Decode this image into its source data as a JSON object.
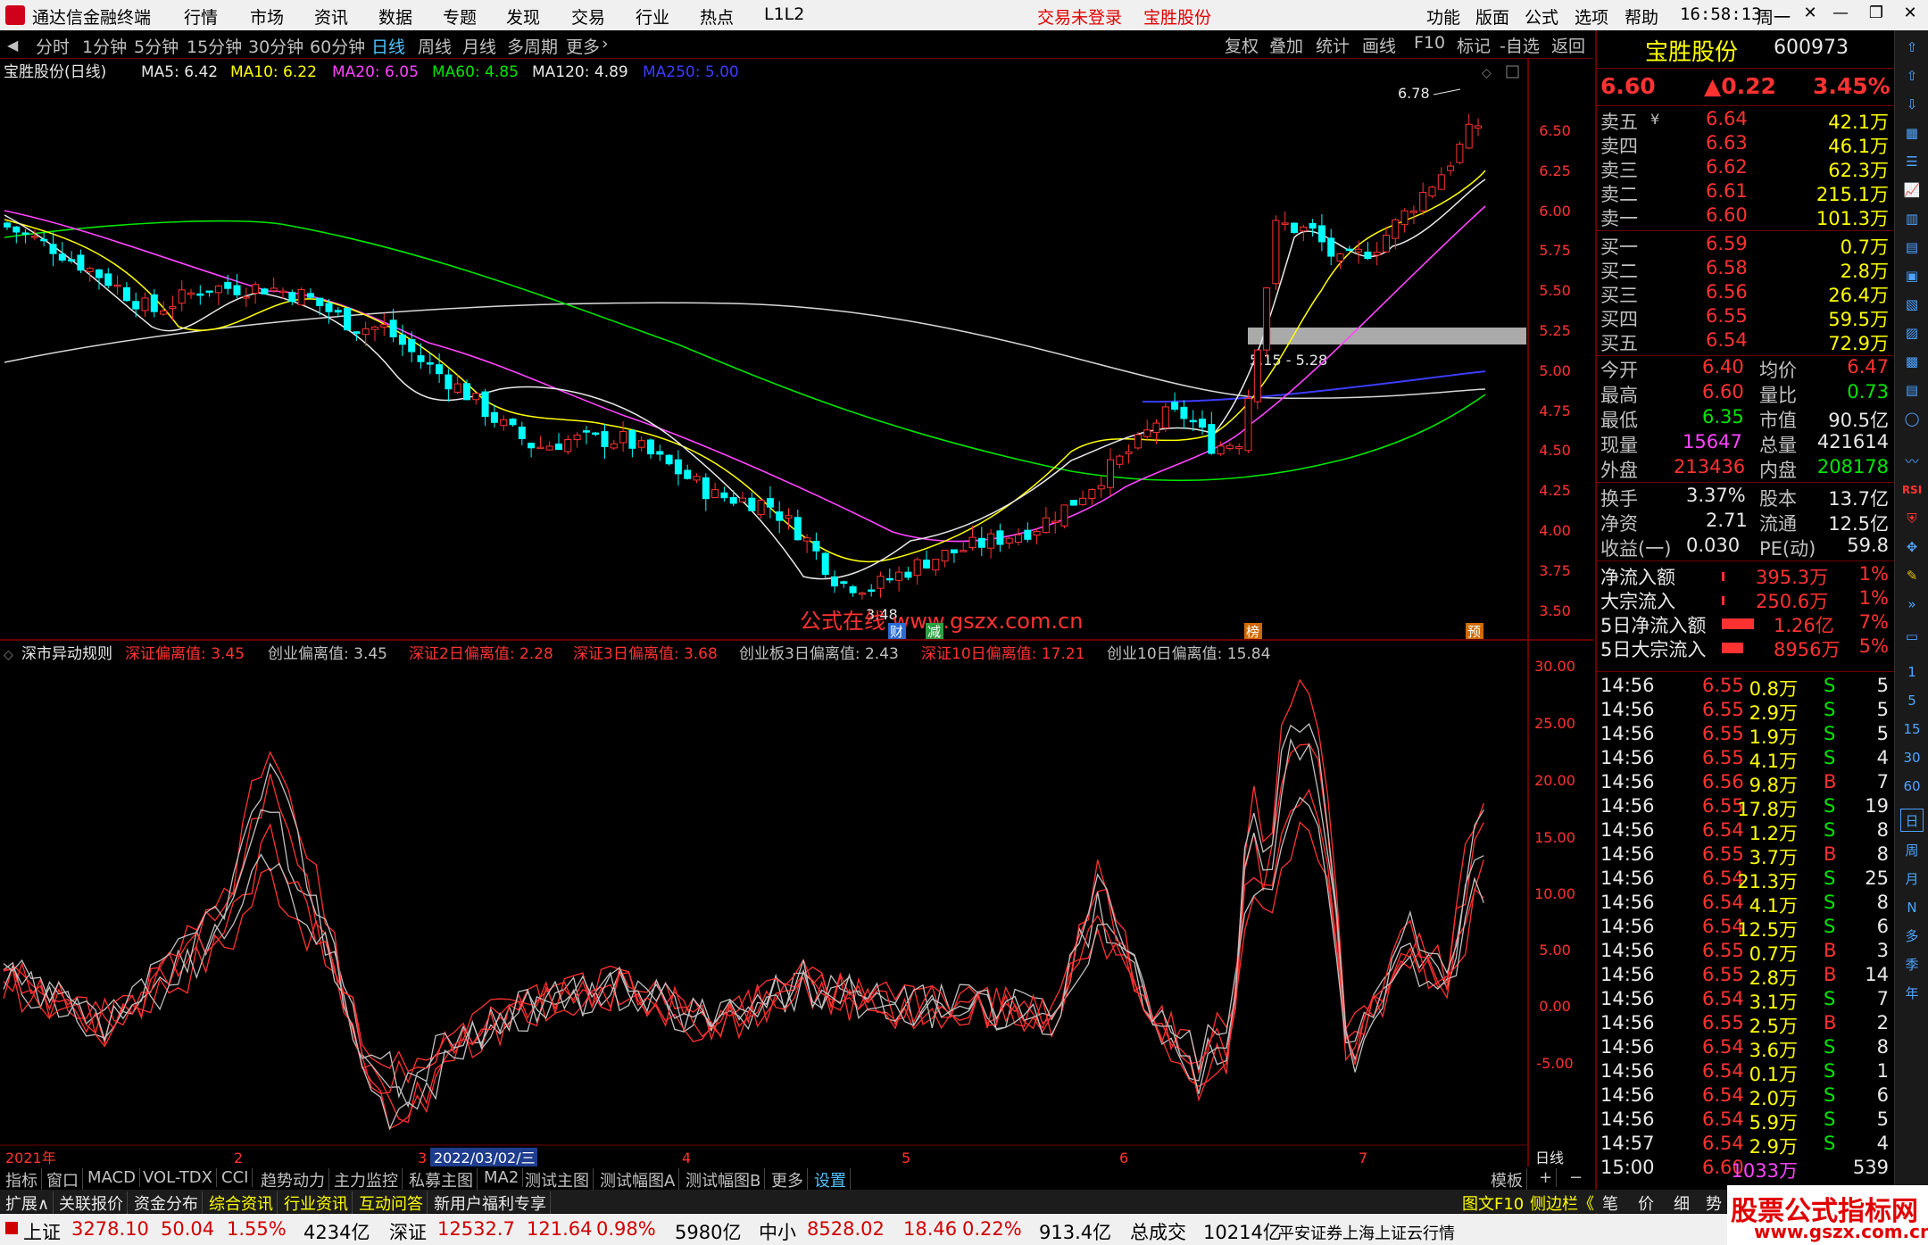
{
  "app": {
    "title": "通达信金融终端",
    "menu": [
      "行情",
      "市场",
      "资讯",
      "数据",
      "专题",
      "发现",
      "交易",
      "行业",
      "热点",
      "L1L2"
    ],
    "trade_status": "交易未登录",
    "stock_name_title": "宝胜股份",
    "right_menu": [
      "功能",
      "版面",
      "公式",
      "选项",
      "帮助"
    ],
    "clock": "16:58:13",
    "weekday": "周一"
  },
  "periods": [
    "分时",
    "1分钟",
    "5分钟",
    "15分钟",
    "30分钟",
    "60分钟",
    "日线",
    "周线",
    "月线",
    "多周期",
    "更多"
  ],
  "active_period": "日线",
  "chart_tools": [
    "复权",
    "叠加",
    "统计",
    "画线",
    "F10",
    "标记",
    "-自选",
    "返回"
  ],
  "ma_legend": {
    "title": "宝胜股份(日线)",
    "items": [
      {
        "label": "MA5: 6.42",
        "color": "#e8e8e8"
      },
      {
        "label": "MA10: 6.22",
        "color": "#ffff00"
      },
      {
        "label": "MA20: 6.05",
        "color": "#ff44ff"
      },
      {
        "label": "MA60: 4.85",
        "color": "#00e600"
      },
      {
        "label": "MA120: 4.89",
        "color": "#e8e8e8"
      },
      {
        "label": "MA250: 5.00",
        "color": "#3c3cff"
      }
    ]
  },
  "price_axis": [
    "6.50",
    "6.25",
    "6.00",
    "5.75",
    "5.50",
    "5.25",
    "5.00",
    "4.75",
    "4.50",
    "4.25",
    "4.00",
    "3.75",
    "3.50"
  ],
  "annotations": {
    "high": "6.78",
    "low": "3.48",
    "zone": "5.15 - 5.28",
    "watermark": "公式在线 www.gszx.com.cn",
    "badges": [
      "财",
      "减",
      "榜",
      "预"
    ]
  },
  "indicator": {
    "title": "深市异动规则",
    "items": [
      {
        "label": "深证偏离值: 3.45",
        "color": "#ff3232"
      },
      {
        "label": "创业偏离值: 3.45",
        "color": "#c0c0c0"
      },
      {
        "label": "深证2日偏离值: 2.28",
        "color": "#ff3232"
      },
      {
        "label": "深证3日偏离值: 3.68",
        "color": "#ff3232"
      },
      {
        "label": "创业板3日偏离值: 2.43",
        "color": "#c0c0c0"
      },
      {
        "label": "深证10日偏离值: 17.21",
        "color": "#ff3232"
      },
      {
        "label": "创业10日偏离值: 15.84",
        "color": "#c0c0c0"
      }
    ],
    "axis": [
      "30.00",
      "25.00",
      "20.00",
      "15.00",
      "10.00",
      "5.00",
      "0.00",
      "-5.00"
    ]
  },
  "date_axis": {
    "labels": [
      "2021年",
      "2",
      "3",
      "4",
      "5",
      "6",
      "7"
    ],
    "cursor_date": "2022/03/02/三",
    "period_tag": "日线"
  },
  "quote": {
    "name": "宝胜股份",
    "code": "600973",
    "price": "6.60",
    "change": "▲0.22",
    "change_pct": "3.45%",
    "asks": [
      {
        "label": "卖五",
        "price": "6.64",
        "vol": "42.1万"
      },
      {
        "label": "卖四",
        "price": "6.63",
        "vol": "46.1万"
      },
      {
        "label": "卖三",
        "price": "6.62",
        "vol": "62.3万"
      },
      {
        "label": "卖二",
        "price": "6.61",
        "vol": "215.1万"
      },
      {
        "label": "卖一",
        "price": "6.60",
        "vol": "101.3万"
      }
    ],
    "bids": [
      {
        "label": "买一",
        "price": "6.59",
        "vol": "0.7万"
      },
      {
        "label": "买二",
        "price": "6.58",
        "vol": "2.8万"
      },
      {
        "label": "买三",
        "price": "6.56",
        "vol": "26.4万"
      },
      {
        "label": "买四",
        "price": "6.55",
        "vol": "59.5万"
      },
      {
        "label": "买五",
        "price": "6.54",
        "vol": "72.9万"
      }
    ],
    "stats": [
      {
        "k1": "今开",
        "v1": "6.40",
        "c1": "red",
        "k2": "均价",
        "v2": "6.47",
        "c2": "red"
      },
      {
        "k1": "最高",
        "v1": "6.60",
        "c1": "red",
        "k2": "量比",
        "v2": "0.73",
        "c2": "green"
      },
      {
        "k1": "最低",
        "v1": "6.35",
        "c1": "green",
        "k2": "市值",
        "v2": "90.5亿",
        "c2": "white"
      },
      {
        "k1": "现量",
        "v1": "15647",
        "c1": "magenta",
        "k2": "总量",
        "v2": "421614",
        "c2": "white"
      },
      {
        "k1": "外盘",
        "v1": "213436",
        "c1": "red",
        "k2": "内盘",
        "v2": "208178",
        "c2": "green"
      }
    ],
    "fund": [
      {
        "k1": "换手",
        "v1": "3.37%",
        "k2": "股本",
        "v2": "13.7亿"
      },
      {
        "k1": "净资",
        "v1": "2.71",
        "k2": "流通",
        "v2": "12.5亿"
      },
      {
        "k1": "收益(一)",
        "v1": "0.030",
        "k2": "PE(动)",
        "v2": "59.8"
      }
    ],
    "flows": [
      {
        "k": "净流入额",
        "v": "395.3万",
        "p": "1%"
      },
      {
        "k": "大宗流入",
        "v": "250.6万",
        "p": "1%"
      },
      {
        "k": "5日净流入额",
        "v": "1.26亿",
        "p": "7%"
      },
      {
        "k": "5日大宗流入",
        "v": "8956万",
        "p": "5%"
      }
    ],
    "ticks": [
      {
        "t": "14:56",
        "p": "6.55",
        "v": "0.8万",
        "d": "S",
        "n": "5"
      },
      {
        "t": "14:56",
        "p": "6.55",
        "v": "2.9万",
        "d": "S",
        "n": "5"
      },
      {
        "t": "14:56",
        "p": "6.55",
        "v": "1.9万",
        "d": "S",
        "n": "5"
      },
      {
        "t": "14:56",
        "p": "6.55",
        "v": "4.1万",
        "d": "S",
        "n": "4"
      },
      {
        "t": "14:56",
        "p": "6.56",
        "v": "9.8万",
        "d": "B",
        "n": "7"
      },
      {
        "t": "14:56",
        "p": "6.55",
        "v": "17.8万",
        "d": "S",
        "n": "19"
      },
      {
        "t": "14:56",
        "p": "6.54",
        "v": "1.2万",
        "d": "S",
        "n": "8"
      },
      {
        "t": "14:56",
        "p": "6.55",
        "v": "3.7万",
        "d": "B",
        "n": "8"
      },
      {
        "t": "14:56",
        "p": "6.54",
        "v": "21.3万",
        "d": "S",
        "n": "25"
      },
      {
        "t": "14:56",
        "p": "6.54",
        "v": "4.1万",
        "d": "S",
        "n": "8"
      },
      {
        "t": "14:56",
        "p": "6.54",
        "v": "12.5万",
        "d": "S",
        "n": "6"
      },
      {
        "t": "14:56",
        "p": "6.55",
        "v": "0.7万",
        "d": "B",
        "n": "3"
      },
      {
        "t": "14:56",
        "p": "6.55",
        "v": "2.8万",
        "d": "B",
        "n": "14"
      },
      {
        "t": "14:56",
        "p": "6.54",
        "v": "3.1万",
        "d": "S",
        "n": "7"
      },
      {
        "t": "14:56",
        "p": "6.55",
        "v": "2.5万",
        "d": "B",
        "n": "2"
      },
      {
        "t": "14:56",
        "p": "6.54",
        "v": "3.6万",
        "d": "S",
        "n": "8"
      },
      {
        "t": "14:56",
        "p": "6.54",
        "v": "0.1万",
        "d": "S",
        "n": "1"
      },
      {
        "t": "14:56",
        "p": "6.54",
        "v": "2.0万",
        "d": "S",
        "n": "6"
      },
      {
        "t": "14:56",
        "p": "6.54",
        "v": "5.9万",
        "d": "S",
        "n": "5"
      },
      {
        "t": "14:57",
        "p": "6.54",
        "v": "2.9万",
        "d": "S",
        "n": "4"
      },
      {
        "t": "15:00",
        "p": "6.60",
        "v": "1033万",
        "d": "",
        "n": "539"
      }
    ]
  },
  "side_icons": [
    "arrow-up-icon",
    "arrow-down-icon",
    "grid-icon",
    "chart-icon",
    "list-icon",
    "line-icon",
    "bar-icon",
    "book-icon",
    "news-icon",
    "f10-icon",
    "fz-icon",
    "layout-icon",
    "circle-icon",
    "wave-icon",
    "rsi-icon",
    "shield-icon",
    "move-icon",
    "pen-icon",
    "chevron-right-icon"
  ],
  "side_icon_text": [
    "RSI",
    "1",
    "5",
    "15",
    "30",
    "60",
    "日",
    "周",
    "月",
    "N",
    "多",
    "季",
    "年"
  ],
  "tabs1": [
    "指标",
    "窗口",
    "MACD",
    "VOL-TDX",
    "CCI",
    "趋势动力",
    "主力监控",
    "私募主图",
    "MA2",
    "测试主图",
    "测试幅图A",
    "测试幅图B",
    "更多",
    "设置",
    "模板",
    "+",
    "−"
  ],
  "tabs2": [
    "扩展∧",
    "关联报价",
    "资金分布",
    "综合资讯",
    "行业资讯",
    "互动问答",
    "新用户福利专享"
  ],
  "tabs2_right": [
    "图文F10",
    "侧边栏《",
    "笔",
    "价",
    "细",
    "势"
  ],
  "status": {
    "sh_label": "上证",
    "sh_val": "3278.10",
    "sh_chg": "50.04",
    "sh_pct": "1.55%",
    "sh_amt": "4234亿",
    "sz_label": "深证",
    "sz_val": "12532.7",
    "sz_chg": "121.64",
    "sz_pct": "0.98%",
    "sz_amt": "5980亿",
    "zx_label": "中小",
    "zx_val": "8528.02",
    "zx_chg": "18.46",
    "zx_pct": "0.22%",
    "zx_amt": "913.4亿",
    "total_label": "总成交",
    "total_val": "10214亿",
    "broker": "平安证券上海上证云行情"
  },
  "brand": {
    "line1": "股票公式指标网",
    "line2": "www.gszx.com.cn"
  },
  "colors": {
    "up": "#ff3232",
    "down": "#00ffff",
    "bg": "#000000",
    "frame": "#6b0000",
    "accent": "#ffff00"
  }
}
